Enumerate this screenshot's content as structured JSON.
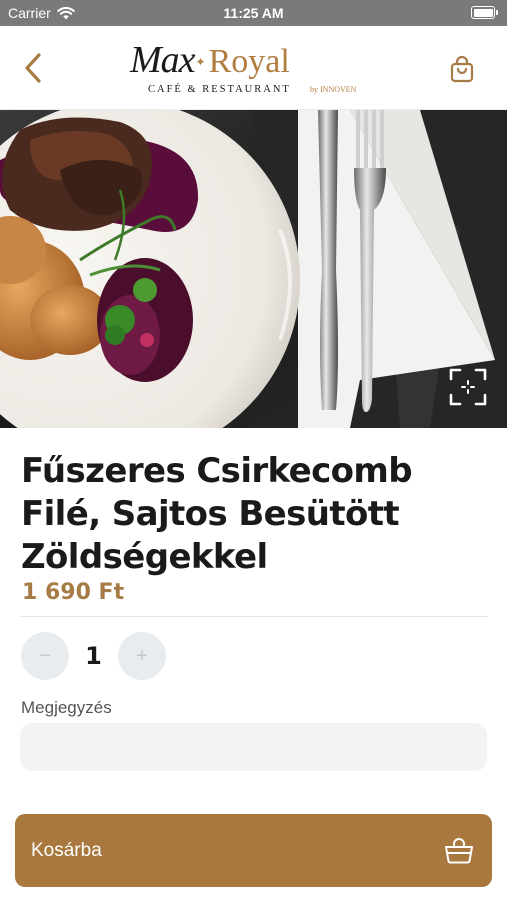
{
  "status_bar": {
    "carrier": "Carrier",
    "time": "11:25 AM"
  },
  "header": {
    "logo": {
      "max": "Max",
      "royal": "Royal",
      "subtitle": "CAFÉ & RESTAURANT",
      "by": "by INNOVEN"
    },
    "icons": {
      "back": "chevron-left-icon",
      "cart": "shopping-bag-icon"
    }
  },
  "product": {
    "title": "Fűszeres Csirkecomb Filé, Sajtos Besütött Zöldségekkel",
    "price": "1 690 Ft",
    "quantity": "1",
    "minus_label": "−",
    "plus_label": "+",
    "note_label": "Megjegyzés",
    "note_value": ""
  },
  "actions": {
    "add_to_cart_label": "Kosárba"
  },
  "colors": {
    "accent": "#a8783f",
    "price": "#a77b45",
    "status_bar": "#7a7a7a",
    "input_bg": "#f1f3f4",
    "stepper_bg": "#e9ecee"
  }
}
